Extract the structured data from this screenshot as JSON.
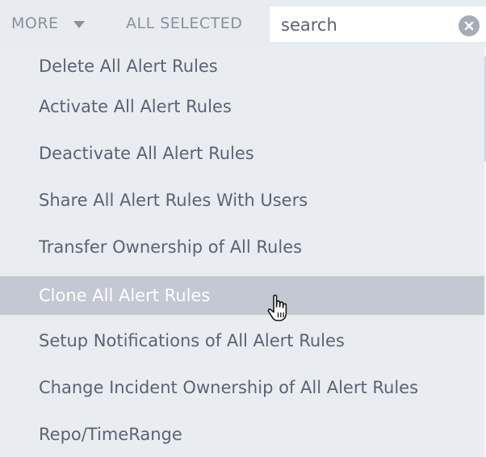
{
  "toolbar": {
    "more_label": "MORE",
    "all_selected_label": "ALL SELECTED"
  },
  "search": {
    "value": "",
    "placeholder": "search"
  },
  "menu": {
    "hovered_index": 5,
    "items": [
      {
        "label": "Delete All Alert Rules"
      },
      {
        "label": "Activate All Alert Rules"
      },
      {
        "label": "Deactivate All Alert Rules"
      },
      {
        "label": "Share All Alert Rules With Users"
      },
      {
        "label": "Transfer Ownership of All Rules"
      },
      {
        "label": "Clone All Alert Rules"
      },
      {
        "label": "Setup Notifications of All Alert Rules"
      },
      {
        "label": "Change Incident Ownership of All Alert Rules"
      },
      {
        "label": "Repo/TimeRange"
      }
    ]
  },
  "icons": {
    "more_caret": "chevron-down-icon",
    "clear": "close-icon",
    "pointer": "hand-pointer-icon"
  },
  "colors": {
    "background": "#e9ecf0",
    "hover": "#c3c8d2",
    "text": "#5b6474",
    "muted": "#8a919c"
  }
}
